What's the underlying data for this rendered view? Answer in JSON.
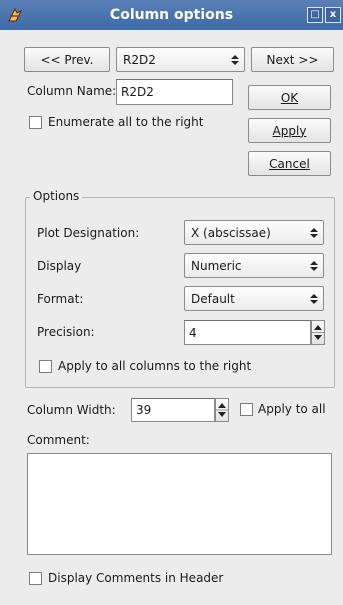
{
  "window": {
    "title": "Column options",
    "buttons": {
      "restore": "□",
      "close": "x"
    }
  },
  "nav": {
    "prev_label": "<< Prev.",
    "next_label": "Next >>",
    "column_selector_value": "R2D2"
  },
  "column_name": {
    "label": "Column Name:",
    "value": "R2D2"
  },
  "enumerate": {
    "label": "Enumerate all to the right",
    "checked": false
  },
  "actions": {
    "ok": "OK",
    "apply": "Apply",
    "cancel": "Cancel"
  },
  "options": {
    "group_title": "Options",
    "plot_designation": {
      "label": "Plot Designation:",
      "value": "X (abscissae)"
    },
    "display": {
      "label": "Display",
      "value": "Numeric"
    },
    "format": {
      "label": "Format:",
      "value": "Default"
    },
    "precision": {
      "label": "Precision:",
      "value": "4"
    },
    "apply_right": {
      "label": "Apply to all columns to the right",
      "checked": false
    }
  },
  "width": {
    "label": "Column Width:",
    "value": "39",
    "apply_all_label": "Apply to all",
    "apply_all_checked": false
  },
  "comment": {
    "label": "Comment:",
    "value": ""
  },
  "display_comments": {
    "label": "Display Comments in Header",
    "checked": false
  },
  "colors": {
    "titlebar": "#4a74b0",
    "window_bg": "#ececec"
  }
}
